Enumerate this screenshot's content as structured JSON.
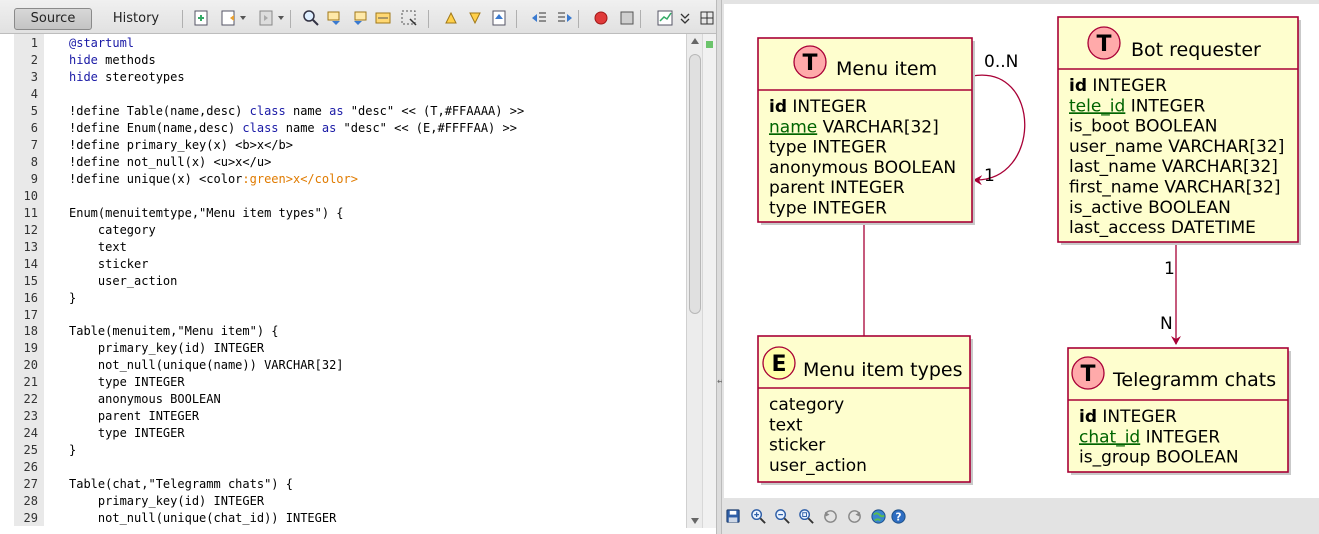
{
  "toolbar": {
    "tabs": [
      "Source",
      "History"
    ],
    "icons": [
      "last-edit-icon",
      "back-icon",
      "forward-icon",
      "find-icon",
      "find-previous-icon",
      "find-next-icon",
      "toggle-highlight-icon",
      "toggle-rect-selection-icon",
      "previous-bookmark-icon",
      "next-bookmark-icon",
      "toggle-bookmark-icon",
      "shift-left-icon",
      "shift-right-icon",
      "start-macro-icon",
      "stop-macro-icon",
      "chart-icon",
      "expand-icon",
      "split-icon"
    ]
  },
  "editor": {
    "lines": [
      [
        {
          "t": "@startuml",
          "c": "kw"
        }
      ],
      [
        {
          "t": "hide",
          "c": "kw"
        },
        {
          "t": " methods"
        }
      ],
      [
        {
          "t": "hide",
          "c": "kw"
        },
        {
          "t": " stereotypes"
        }
      ],
      [],
      [
        {
          "t": "!define Table(name,desc) "
        },
        {
          "t": "class",
          "c": "kw"
        },
        {
          "t": " name "
        },
        {
          "t": "as",
          "c": "kw"
        },
        {
          "t": " \"desc\" << (T,#FFAAAA) >>"
        }
      ],
      [
        {
          "t": "!define Enum(name,desc) "
        },
        {
          "t": "class",
          "c": "kw"
        },
        {
          "t": " name "
        },
        {
          "t": "as",
          "c": "kw"
        },
        {
          "t": " \"desc\" << (E,#FFFFAA) >>"
        }
      ],
      [
        {
          "t": "!define primary_key(x) <b>x</b>"
        }
      ],
      [
        {
          "t": "!define not_null(x) <u>x</u>"
        }
      ],
      [
        {
          "t": "!define unique(x) <color"
        },
        {
          "t": ":green>x</color>",
          "c": "or"
        }
      ],
      [],
      [
        {
          "t": "Enum(menuitemtype,\"Menu item types\") {"
        }
      ],
      [
        {
          "t": "    category"
        }
      ],
      [
        {
          "t": "    text"
        }
      ],
      [
        {
          "t": "    sticker"
        }
      ],
      [
        {
          "t": "    user_action"
        }
      ],
      [
        {
          "t": "}"
        }
      ],
      [],
      [
        {
          "t": "Table(menuitem,\"Menu item\") {"
        }
      ],
      [
        {
          "t": "    primary_key(id) INTEGER"
        }
      ],
      [
        {
          "t": "    not_null(unique(name)) VARCHAR[32]"
        }
      ],
      [
        {
          "t": "    type INTEGER"
        }
      ],
      [
        {
          "t": "    anonymous BOOLEAN"
        }
      ],
      [
        {
          "t": "    parent INTEGER"
        }
      ],
      [
        {
          "t": "    type INTEGER"
        }
      ],
      [
        {
          "t": "}"
        }
      ],
      [],
      [
        {
          "t": "Table(chat,\"Telegramm chats\") {"
        }
      ],
      [
        {
          "t": "    primary_key(id) INTEGER"
        }
      ],
      [
        {
          "t": "    not_null(unique(chat_id)) INTEGER"
        }
      ]
    ]
  },
  "diagram": {
    "colors": {
      "entity_fill": "#FEFECE",
      "border": "#A80036",
      "t_badge": "#FFAAAA",
      "e_badge": "#FFFFAA",
      "unique": "#006400"
    },
    "entities": [
      {
        "key": "menuitem",
        "letter": "T",
        "title": "Menu item",
        "fields": [
          [
            {
              "t": "id",
              "b": true
            },
            {
              "t": " INTEGER"
            }
          ],
          [
            {
              "t": "name",
              "u": true
            },
            {
              "t": " VARCHAR[32]"
            }
          ],
          [
            {
              "t": "type INTEGER"
            }
          ],
          [
            {
              "t": "anonymous BOOLEAN"
            }
          ],
          [
            {
              "t": "parent INTEGER"
            }
          ],
          [
            {
              "t": "type INTEGER"
            }
          ]
        ]
      },
      {
        "key": "botrequester",
        "letter": "T",
        "title": "Bot requester",
        "fields": [
          [
            {
              "t": "id",
              "b": true
            },
            {
              "t": " INTEGER"
            }
          ],
          [
            {
              "t": "tele_id",
              "u": true
            },
            {
              "t": " INTEGER"
            }
          ],
          [
            {
              "t": "is_boot BOOLEAN"
            }
          ],
          [
            {
              "t": "user_name VARCHAR[32]"
            }
          ],
          [
            {
              "t": "last_name VARCHAR[32]"
            }
          ],
          [
            {
              "t": "first_name VARCHAR[32]"
            }
          ],
          [
            {
              "t": "is_active BOOLEAN"
            }
          ],
          [
            {
              "t": "last_access DATETIME"
            }
          ]
        ]
      },
      {
        "key": "menuitemtype",
        "letter": "E",
        "title": "Menu item types",
        "fields": [
          [
            {
              "t": "category"
            }
          ],
          [
            {
              "t": "text"
            }
          ],
          [
            {
              "t": "sticker"
            }
          ],
          [
            {
              "t": "user_action"
            }
          ]
        ]
      },
      {
        "key": "chat",
        "letter": "T",
        "title": "Telegramm chats",
        "fields": [
          [
            {
              "t": "id",
              "b": true
            },
            {
              "t": " INTEGER"
            }
          ],
          [
            {
              "t": "chat_id",
              "u": true
            },
            {
              "t": " INTEGER"
            }
          ],
          [
            {
              "t": "is_group BOOLEAN"
            }
          ]
        ]
      }
    ],
    "labels": {
      "self_many": "0..N",
      "self_one": "1",
      "bot_one": "1",
      "chat_many": "N"
    }
  },
  "diagram_toolbar": {
    "icons": [
      "save-icon",
      "zoom-in-icon",
      "zoom-out-icon",
      "zoom-fit-icon",
      "rotate-left-icon",
      "rotate-right-icon",
      "browser-icon",
      "help-icon"
    ]
  }
}
